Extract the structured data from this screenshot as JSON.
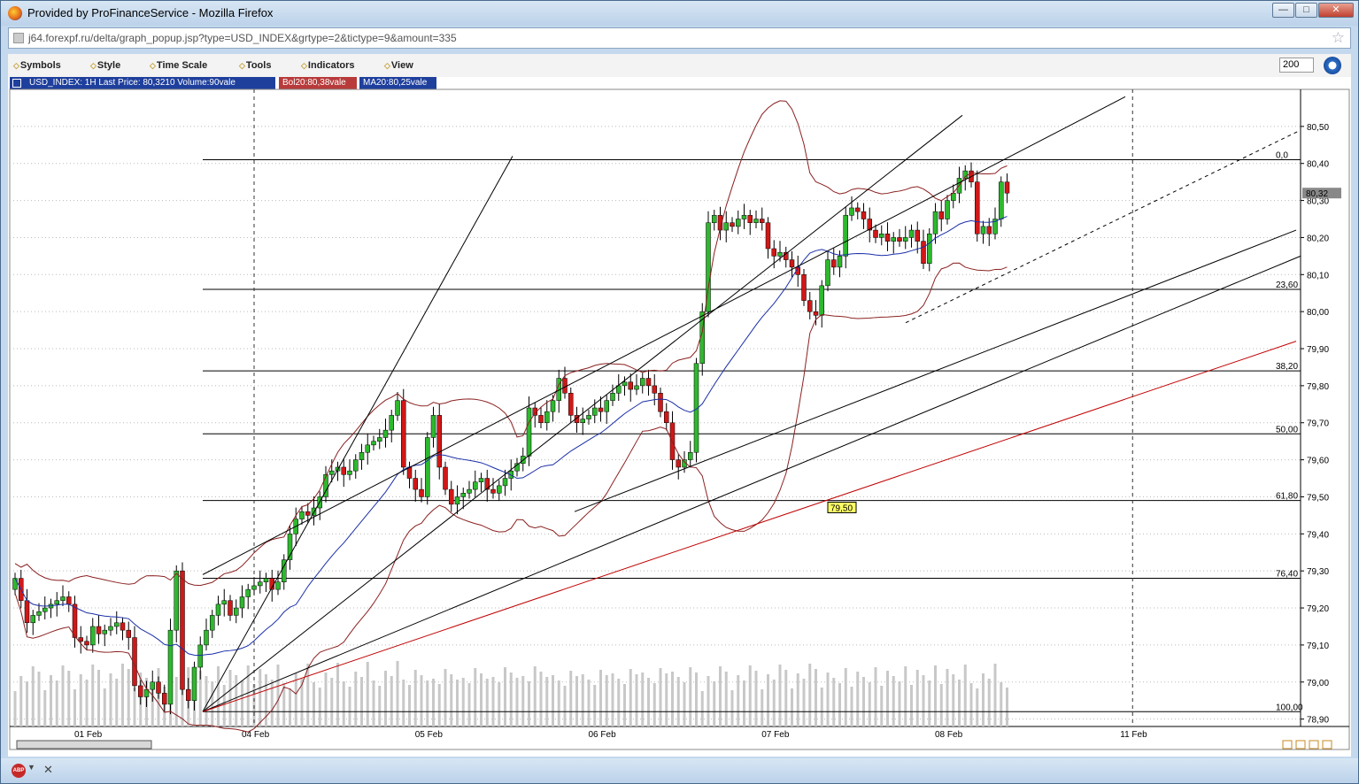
{
  "window": {
    "title": "Provided by ProFinanceService - Mozilla Firefox",
    "buttons": [
      "—",
      "□",
      "✕"
    ]
  },
  "address": {
    "url": "j64.forexpf.ru/delta/graph_popup.jsp?type=USD_INDEX&grtype=2&tictype=9&amount=335"
  },
  "menu": {
    "items": [
      "Symbols",
      "Style",
      "Time Scale",
      "Tools",
      "Indicators",
      "View"
    ],
    "amount_value": "200"
  },
  "info": {
    "main": "USD_INDEX: 1H Last Price: 80,3210 Volume:90vale",
    "bol": "Bol20:80,38vale",
    "ma": "MA20:80,25vale"
  },
  "chart_data": {
    "type": "candlestick",
    "symbol": "USD_INDEX",
    "timeframe": "1H",
    "last_price": "80,32",
    "ylim": [
      78.88,
      80.6
    ],
    "y_ticks": [
      "80,50",
      "80,40",
      "80,30",
      "80,20",
      "80,10",
      "80,00",
      "79,90",
      "79,80",
      "79,70",
      "79,60",
      "79,50",
      "79,40",
      "79,30",
      "79,20",
      "79,10",
      "79,00",
      "78,90"
    ],
    "x_labels": [
      "01 Feb",
      "04 Feb",
      "05 Feb",
      "06 Feb",
      "07 Feb",
      "08 Feb",
      "11 Feb"
    ],
    "fib_levels": [
      {
        "label": "0,0",
        "value": 80.41
      },
      {
        "label": "23,60",
        "value": 80.06
      },
      {
        "label": "38,20",
        "value": 79.84
      },
      {
        "label": "50,00",
        "value": 79.67
      },
      {
        "label": "61,80",
        "value": 79.49
      },
      {
        "label": "76,40",
        "value": 79.28
      },
      {
        "label": "100,00",
        "value": 78.92
      }
    ],
    "annotation": {
      "label": "79,50"
    },
    "closes": [
      79.28,
      79.22,
      79.16,
      79.18,
      79.19,
      79.2,
      79.21,
      79.22,
      79.23,
      79.21,
      79.12,
      79.11,
      79.1,
      79.15,
      79.13,
      79.14,
      79.15,
      79.16,
      79.14,
      79.12,
      78.99,
      78.96,
      78.98,
      79.0,
      78.97,
      78.94,
      79.14,
      79.3,
      78.98,
      78.95,
      79.04,
      79.1,
      79.14,
      79.18,
      79.21,
      79.22,
      79.18,
      79.2,
      79.23,
      79.25,
      79.26,
      79.27,
      79.28,
      79.25,
      79.27,
      79.33,
      79.4,
      79.44,
      79.46,
      79.45,
      79.47,
      79.5,
      79.56,
      79.57,
      79.58,
      79.56,
      79.57,
      79.6,
      79.62,
      79.64,
      79.65,
      79.66,
      79.68,
      79.72,
      79.76,
      79.58,
      79.55,
      79.52,
      79.5,
      79.66,
      79.72,
      79.58,
      79.52,
      79.48,
      79.5,
      79.51,
      79.52,
      79.54,
      79.55,
      79.52,
      79.51,
      79.53,
      79.55,
      79.57,
      79.59,
      79.61,
      79.74,
      79.72,
      79.7,
      79.73,
      79.76,
      79.82,
      79.78,
      79.72,
      79.7,
      79.71,
      79.72,
      79.74,
      79.73,
      79.76,
      79.78,
      79.8,
      79.81,
      79.79,
      79.8,
      79.82,
      79.8,
      79.78,
      79.73,
      79.7,
      79.6,
      79.58,
      79.6,
      79.62,
      79.86,
      80.0,
      80.24,
      80.26,
      80.22,
      80.24,
      80.23,
      80.25,
      80.26,
      80.24,
      80.25,
      80.24,
      80.17,
      80.15,
      80.16,
      80.14,
      80.12,
      80.1,
      80.03,
      80.0,
      79.99,
      80.07,
      80.14,
      80.12,
      80.15,
      80.26,
      80.28,
      80.27,
      80.25,
      80.22,
      80.2,
      80.21,
      80.19,
      80.2,
      80.19,
      80.2,
      80.22,
      80.19,
      80.13,
      80.21,
      80.27,
      80.25,
      80.3,
      80.32,
      80.36,
      80.38,
      80.35,
      80.21,
      80.23,
      80.21,
      80.25,
      80.35,
      80.32
    ]
  }
}
